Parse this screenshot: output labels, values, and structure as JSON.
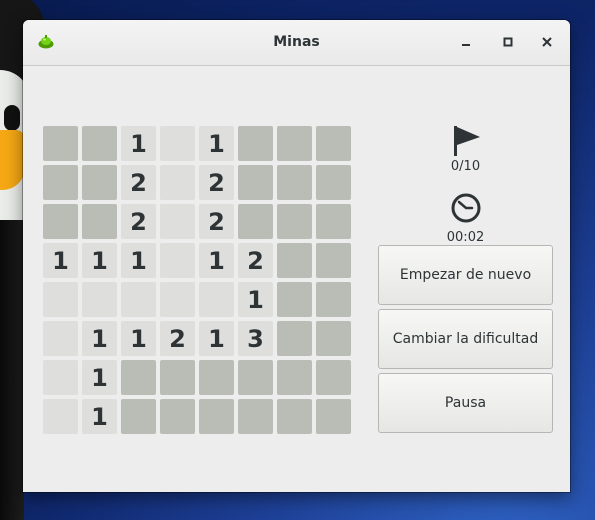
{
  "window": {
    "title": "Minas",
    "app_icon": "green-mine-icon",
    "controls": [
      "minimize-icon",
      "maximize-icon",
      "close-icon"
    ]
  },
  "board": {
    "rows": 8,
    "cols": 8,
    "legend": "C = covered cell, '' = revealed empty cell, digit = revealed number",
    "cells": [
      [
        "C",
        "C",
        "1",
        "",
        "1",
        "C",
        "C",
        "C"
      ],
      [
        "C",
        "C",
        "2",
        "",
        "2",
        "C",
        "C",
        "C"
      ],
      [
        "C",
        "C",
        "2",
        "",
        "2",
        "C",
        "C",
        "C"
      ],
      [
        "1",
        "1",
        "1",
        "",
        "1",
        "2",
        "C",
        "C"
      ],
      [
        "",
        "",
        "",
        "",
        "",
        "1",
        "C",
        "C"
      ],
      [
        "",
        "1",
        "1",
        "2",
        "1",
        "3",
        "C",
        "C"
      ],
      [
        "",
        "1",
        "C",
        "C",
        "C",
        "C",
        "C",
        "C"
      ],
      [
        "",
        "1",
        "C",
        "C",
        "C",
        "C",
        "C",
        "C"
      ]
    ]
  },
  "status": {
    "flag_icon": "flag-icon",
    "flags": "0/10",
    "clock_icon": "clock-icon",
    "time": "00:02"
  },
  "buttons": {
    "new_game": "Empezar de nuevo",
    "change_difficulty": "Cambiar la dificultad",
    "pause": "Pausa"
  },
  "colors": {
    "covered_cell": "#babdb6",
    "revealed_cell": "#dededd",
    "window_bg": "#ededed",
    "text": "#2e3436"
  }
}
